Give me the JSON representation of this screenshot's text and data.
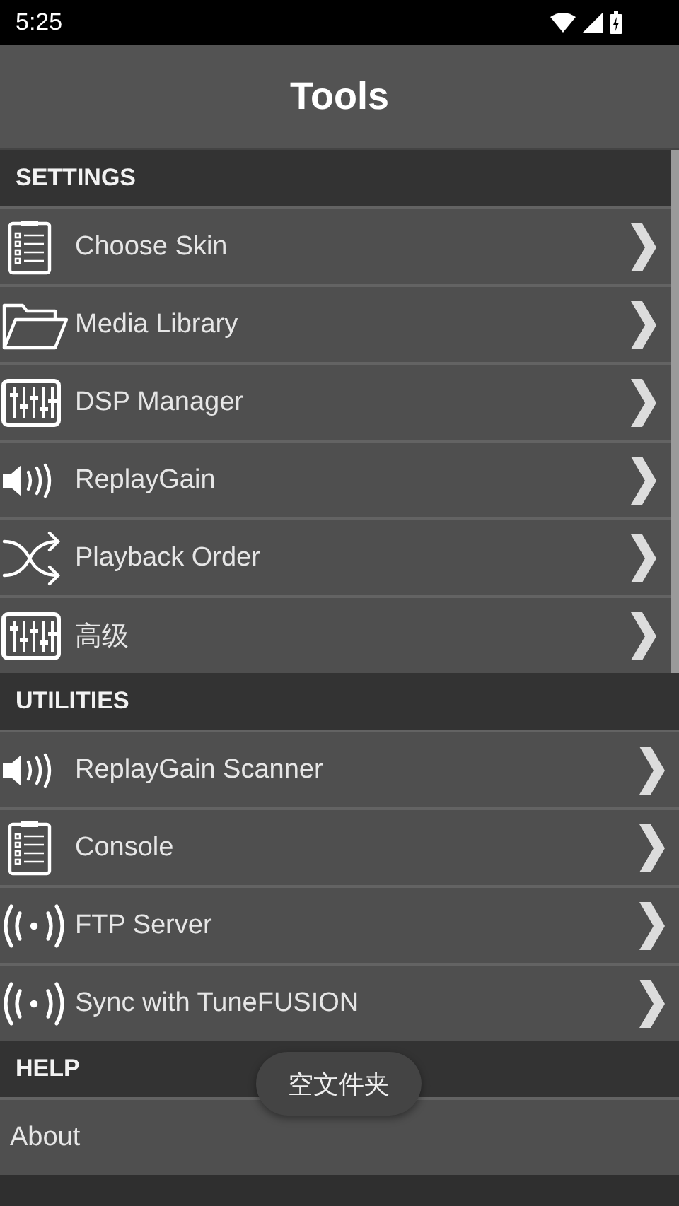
{
  "status_bar": {
    "time": "5:25"
  },
  "header": {
    "title": "Tools"
  },
  "sections": [
    {
      "title": "SETTINGS",
      "items": [
        {
          "label": "Choose Skin",
          "kind": "clipboard",
          "chevron": true
        },
        {
          "label": "Media Library",
          "kind": "folder",
          "chevron": true
        },
        {
          "label": "DSP Manager",
          "kind": "sliders",
          "chevron": true
        },
        {
          "label": "ReplayGain",
          "kind": "speaker",
          "chevron": true
        },
        {
          "label": "Playback Order",
          "kind": "shuffle",
          "chevron": true
        },
        {
          "label": "高级",
          "kind": "sliders",
          "chevron": true
        }
      ]
    },
    {
      "title": "UTILITIES",
      "items": [
        {
          "label": "ReplayGain Scanner",
          "kind": "speaker",
          "chevron": true
        },
        {
          "label": "Console",
          "kind": "clipboard",
          "chevron": true
        },
        {
          "label": "FTP Server",
          "kind": "broadcast",
          "chevron": true
        },
        {
          "label": "Sync with TuneFUSION",
          "kind": "broadcast",
          "chevron": true
        }
      ]
    },
    {
      "title": "HELP",
      "items": [
        {
          "label": "About",
          "kind": "plain",
          "chevron": false
        }
      ]
    }
  ],
  "toast": {
    "text": "空文件夹"
  }
}
